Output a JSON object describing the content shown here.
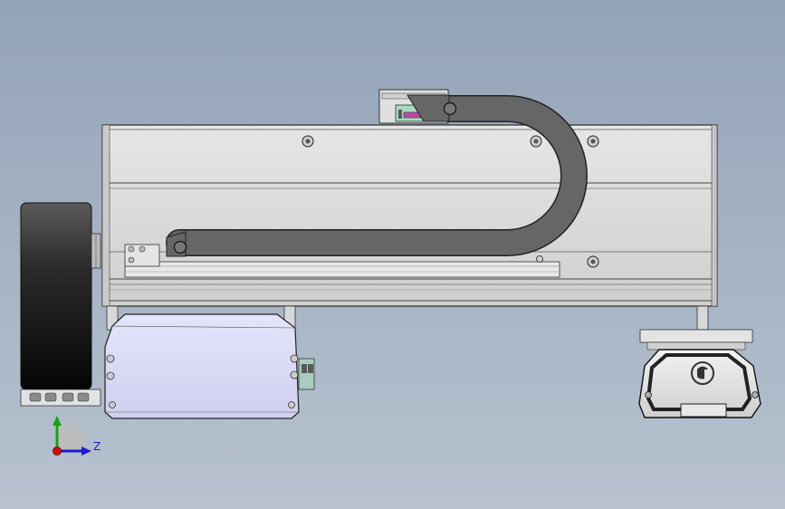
{
  "viewport": {
    "name": "cad-3d-viewport",
    "description_visible": false
  },
  "triad": {
    "z_label": "Z"
  },
  "colors": {
    "background_top": "#93a3b8",
    "background_bottom": "#b8c2cf",
    "housing": "#d9d9d9",
    "housing_edge": "#2a2a2a",
    "cable_chain": "#666666",
    "motor_cover": "#dcdcf4",
    "wheel": "#1c1c1c",
    "axis_x": "#1b1bcc",
    "axis_y": "#18a018",
    "axis_origin": "#cc1010",
    "connector_accent": "#b84aa8"
  },
  "icons": {
    "logo_on_module": "swirl-logo-icon"
  }
}
